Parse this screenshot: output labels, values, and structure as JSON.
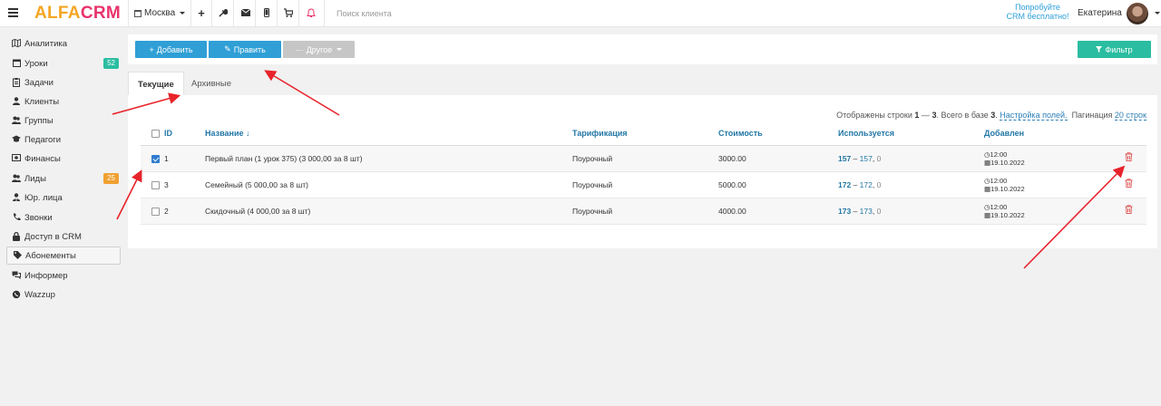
{
  "topbar": {
    "logo_a": "ALFA",
    "logo_b": "CRM",
    "branch": "Москва",
    "search_placeholder": "Поиск клиента",
    "promo_line1": "Попробуйте",
    "promo_line2": "CRM бесплатно!",
    "username": "Екатерина",
    "icons": [
      "plus-icon",
      "wrench-icon",
      "envelope-icon",
      "phone-icon",
      "cart-icon",
      "bell-icon"
    ],
    "bell_color": "#e8336b"
  },
  "sidebar": {
    "items": [
      {
        "label": "Аналитика",
        "icon": "map-icon"
      },
      {
        "label": "Уроки",
        "icon": "calendar-icon",
        "badge": "52",
        "badge_color": "#2bbda1"
      },
      {
        "label": "Задачи",
        "icon": "clipboard-icon"
      },
      {
        "label": "Клиенты",
        "icon": "user-icon"
      },
      {
        "label": "Группы",
        "icon": "users-icon"
      },
      {
        "label": "Педагоги",
        "icon": "graduation-cap-icon"
      },
      {
        "label": "Финансы",
        "icon": "money-icon"
      },
      {
        "label": "Лиды",
        "icon": "users-icon",
        "badge": "25",
        "badge_color": "#f0a030"
      },
      {
        "label": "Юр. лица",
        "icon": "user-tie-icon"
      },
      {
        "label": "Звонки",
        "icon": "phone-icon"
      },
      {
        "label": "Доступ в CRM",
        "icon": "lock-icon"
      },
      {
        "label": "Абонементы",
        "icon": "tag-icon",
        "active": true
      },
      {
        "label": "Информер",
        "icon": "comments-icon"
      },
      {
        "label": "Wazzup",
        "icon": "whatsapp-icon"
      }
    ]
  },
  "toolbar": {
    "add_label": "Добавить",
    "edit_label": "Править",
    "other_label": "Другое",
    "filter_label": "Фильтр",
    "primary_color": "#2f9fd6",
    "filter_color": "#2bbda1"
  },
  "tabs": [
    {
      "label": "Текущие",
      "active": true
    },
    {
      "label": "Архивные",
      "active": false
    }
  ],
  "table_info": {
    "shown_prefix": "Отображены строки",
    "range_start": "1",
    "range_end": "3",
    "total_prefix": ". Всего в базе",
    "total": "3",
    "fields_link": "Настройка полей.",
    "pagination_label": "Пагинация",
    "pagination_value": "20 строк"
  },
  "table": {
    "headers": [
      "ID",
      "Название ↓",
      "Тарификация",
      "Стоимость",
      "Используется",
      "Добавлен"
    ],
    "rows": [
      {
        "checked": true,
        "id": "1",
        "name": "Первый план (1 урок 375) (3 000,00 за 8 шт)",
        "billing": "Поурочный",
        "cost": "3000.00",
        "used_a": "157",
        "used_b": "157",
        "used_c": "0",
        "time": "12:00",
        "date": "19.10.2022"
      },
      {
        "checked": false,
        "id": "3",
        "name": "Семейный (5 000,00 за 8 шт)",
        "billing": "Поурочный",
        "cost": "5000.00",
        "used_a": "172",
        "used_b": "172",
        "used_c": "0",
        "time": "12:00",
        "date": "19.10.2022"
      },
      {
        "checked": false,
        "id": "2",
        "name": "Скидочный (4 000,00 за 8 шт)",
        "billing": "Поурочный",
        "cost": "4000.00",
        "used_a": "173",
        "used_b": "173",
        "used_c": "0",
        "time": "12:00",
        "date": "19.10.2022"
      }
    ]
  },
  "annotations": {
    "arrow_color": "#e8232b"
  }
}
